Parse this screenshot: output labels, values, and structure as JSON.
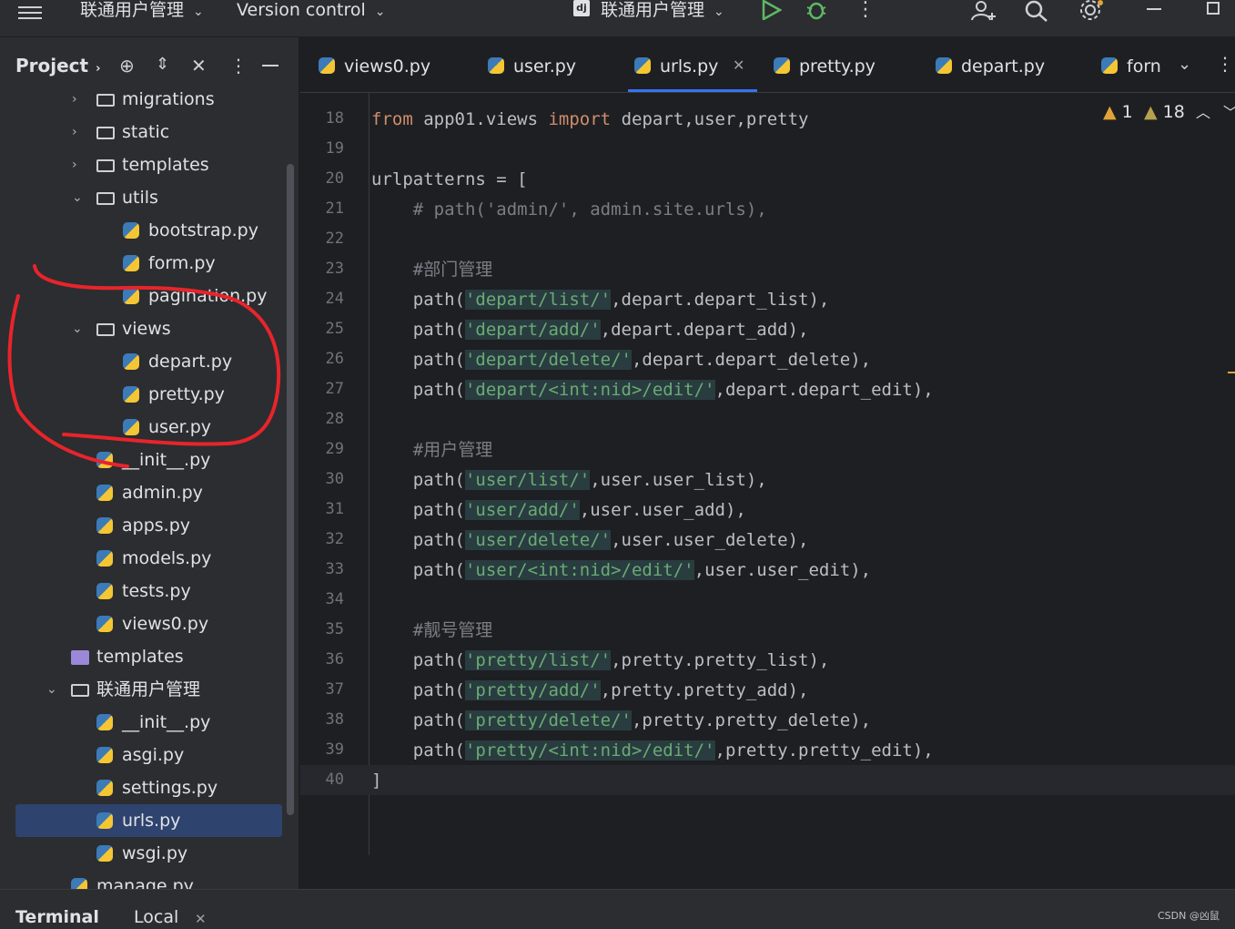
{
  "topbar": {
    "project_name": "联通用户管理",
    "vcs": "Version control",
    "run_config": "联通用户管理",
    "run_config_badge": "dj"
  },
  "project_panel": {
    "title": "Project",
    "tree": [
      {
        "label": "migrations",
        "type": "folder-special",
        "depth": 2,
        "arrow": "›"
      },
      {
        "label": "static",
        "type": "folder",
        "depth": 2,
        "arrow": "›"
      },
      {
        "label": "templates",
        "type": "folder",
        "depth": 2,
        "arrow": "›"
      },
      {
        "label": "utils",
        "type": "folder",
        "depth": 2,
        "arrow": "⌄"
      },
      {
        "label": "bootstrap.py",
        "type": "py",
        "depth": 3
      },
      {
        "label": "form.py",
        "type": "py",
        "depth": 3
      },
      {
        "label": "pagination.py",
        "type": "py",
        "depth": 3
      },
      {
        "label": "views",
        "type": "folder",
        "depth": 2,
        "arrow": "⌄"
      },
      {
        "label": "depart.py",
        "type": "py",
        "depth": 3
      },
      {
        "label": "pretty.py",
        "type": "py",
        "depth": 3
      },
      {
        "label": "user.py",
        "type": "py",
        "depth": 3
      },
      {
        "label": "__init__.py",
        "type": "py",
        "depth": 2
      },
      {
        "label": "admin.py",
        "type": "py",
        "depth": 2
      },
      {
        "label": "apps.py",
        "type": "py",
        "depth": 2
      },
      {
        "label": "models.py",
        "type": "py",
        "depth": 2
      },
      {
        "label": "tests.py",
        "type": "py",
        "depth": 2
      },
      {
        "label": "views0.py",
        "type": "py",
        "depth": 2
      },
      {
        "label": "templates",
        "type": "folder-purple",
        "depth": 1
      },
      {
        "label": "联通用户管理",
        "type": "folder-special",
        "depth": 1,
        "arrow": "⌄"
      },
      {
        "label": "__init__.py",
        "type": "py",
        "depth": 2
      },
      {
        "label": "asgi.py",
        "type": "py",
        "depth": 2
      },
      {
        "label": "settings.py",
        "type": "py",
        "depth": 2
      },
      {
        "label": "urls.py",
        "type": "py",
        "depth": 2,
        "selected": true
      },
      {
        "label": "wsgi.py",
        "type": "py",
        "depth": 2
      },
      {
        "label": "manage.py",
        "type": "py",
        "depth": 1
      }
    ]
  },
  "tabs": [
    {
      "label": "views0.py"
    },
    {
      "label": "user.py"
    },
    {
      "label": "urls.py",
      "active": true
    },
    {
      "label": "pretty.py"
    },
    {
      "label": "depart.py"
    },
    {
      "label": "forn"
    }
  ],
  "inspections": {
    "warnings_a": "1",
    "warnings_b": "18"
  },
  "editor": {
    "lines": [
      {
        "n": "18",
        "html": "<span class='kw'>from</span> app01.views <span class='kw'>import</span> depart,user,pretty"
      },
      {
        "n": "19",
        "html": ""
      },
      {
        "n": "20",
        "html": "urlpatterns = ["
      },
      {
        "n": "21",
        "html": "    <span class='cmt'># path('admin/', admin.site.urls),</span>"
      },
      {
        "n": "22",
        "html": ""
      },
      {
        "n": "23",
        "html": "    <span class='cmt'>#部门管理</span>"
      },
      {
        "n": "24",
        "html": "    path(<span class='str'>'depart/list/'</span>,depart.depart_list),"
      },
      {
        "n": "25",
        "html": "    path(<span class='str'>'depart/add/'</span>,depart.depart_add),"
      },
      {
        "n": "26",
        "html": "    path(<span class='str'>'depart/delete/'</span>,depart.depart_delete),"
      },
      {
        "n": "27",
        "html": "    path(<span class='str'>'depart/&lt;int:nid&gt;/edit/'</span>,depart.depart_edit),"
      },
      {
        "n": "28",
        "html": ""
      },
      {
        "n": "29",
        "html": "    <span class='cmt'>#用户管理</span>"
      },
      {
        "n": "30",
        "html": "    path(<span class='str'>'user/list/'</span>,user.user_list),"
      },
      {
        "n": "31",
        "html": "    path(<span class='str'>'user/add/'</span>,user.user_add),"
      },
      {
        "n": "32",
        "html": "    path(<span class='str'>'user/delete/'</span>,user.user_delete),"
      },
      {
        "n": "33",
        "html": "    path(<span class='str'>'user/&lt;int:nid&gt;/edit/'</span>,user.user_edit),"
      },
      {
        "n": "34",
        "html": ""
      },
      {
        "n": "35",
        "html": "    <span class='cmt'>#靓号管理</span>"
      },
      {
        "n": "36",
        "html": "    path(<span class='str'>'pretty/list/'</span>,pretty.pretty_list),"
      },
      {
        "n": "37",
        "html": "    path(<span class='str'>'pretty/add/'</span>,pretty.pretty_add),"
      },
      {
        "n": "38",
        "html": "    path(<span class='str'>'pretty/delete/'</span>,pretty.pretty_delete),"
      },
      {
        "n": "39",
        "html": "    path(<span class='str'>'pretty/&lt;int:nid&gt;/edit/'</span>,pretty.pretty_edit),"
      },
      {
        "n": "40",
        "html": "]"
      }
    ]
  },
  "bottom": {
    "terminal": "Terminal",
    "local": "Local",
    "watermark": "CSDN @凶鼠"
  }
}
